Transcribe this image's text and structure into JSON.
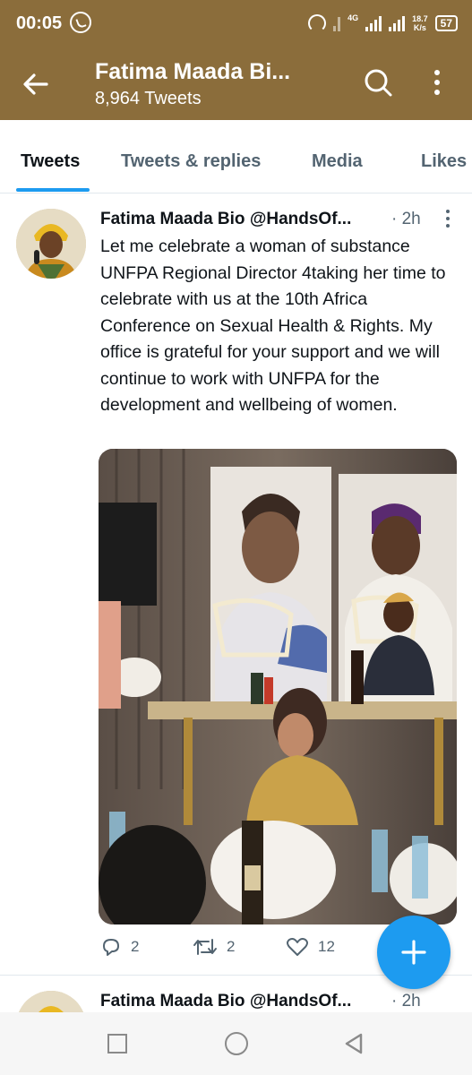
{
  "status_bar": {
    "time": "00:05",
    "network": "4G",
    "speed_value": "18.7",
    "speed_unit": "K/s",
    "battery": "57"
  },
  "app_bar": {
    "title": "Fatima Maada Bi...",
    "subtitle": "8,964 Tweets"
  },
  "tabs": [
    {
      "label": "Tweets",
      "active": true
    },
    {
      "label": "Tweets & replies",
      "active": false
    },
    {
      "label": "Media",
      "active": false
    },
    {
      "label": "Likes",
      "active": false
    }
  ],
  "tweet": {
    "author": "Fatima Maada Bio @HandsOf...",
    "time": "· 2h",
    "text": "Let me celebrate a woman of substance UNFPA Regional Director 4taking her time to celebrate with us at the 10th Africa Conference on Sexual Health & Rights. My office is grateful for your support and we will continue to work with UNFPA for the development and wellbeing of women.",
    "replies": "2",
    "retweets": "2",
    "likes": "12"
  },
  "next_tweet": {
    "author": "Fatima Maada Bio @HandsOf...",
    "time": "· 2h"
  },
  "colors": {
    "header_bg": "#8b6d3b",
    "accent": "#1d9bf0",
    "secondary_text": "#536471"
  }
}
